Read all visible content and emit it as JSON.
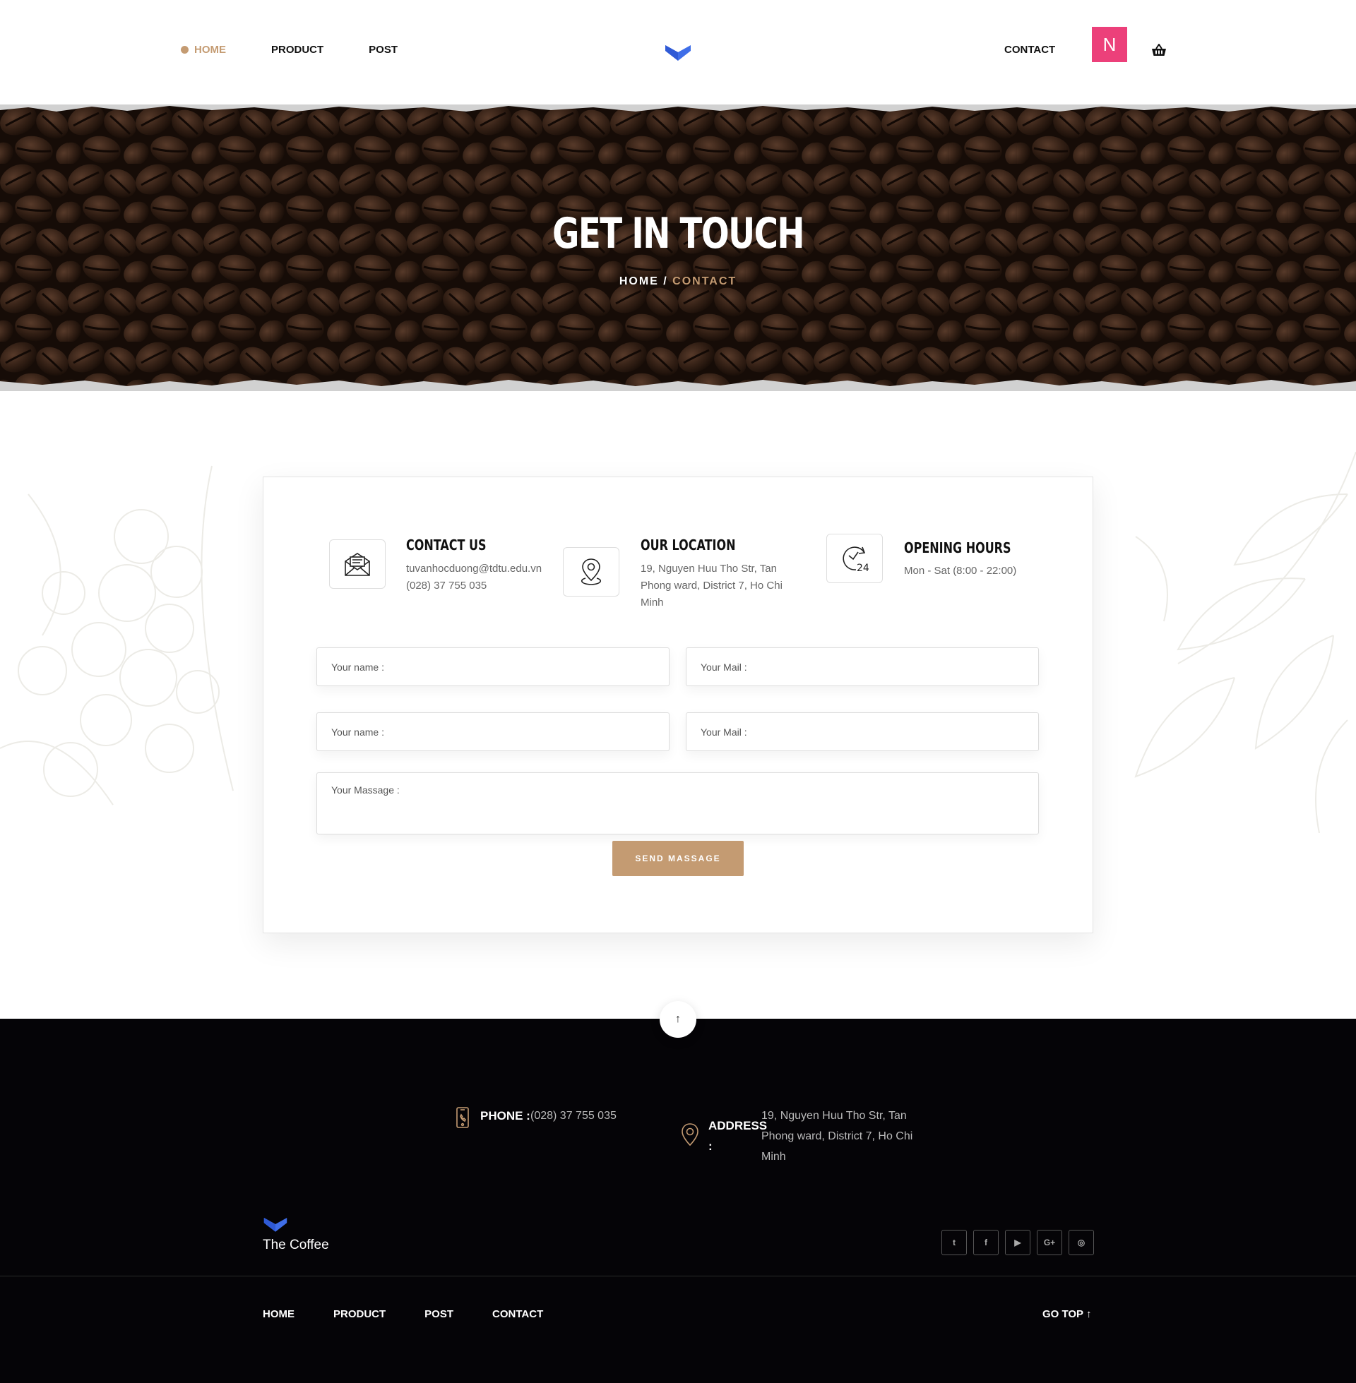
{
  "nav": {
    "items": [
      {
        "label": "HOME",
        "active": true
      },
      {
        "label": "PRODUCT",
        "active": false
      },
      {
        "label": "POST",
        "active": false
      }
    ],
    "contact_label": "CONTACT",
    "avatar_letter": "N"
  },
  "hero": {
    "title": "GET IN TOUCH",
    "breadcrumb_home": "HOME",
    "breadcrumb_separator": " / ",
    "breadcrumb_current": "CONTACT"
  },
  "info": {
    "contact": {
      "title": "CONTACT US",
      "email": "tuvanhocduong@tdtu.edu.vn",
      "phone": "(028) 37 755 035",
      "icon": "mail-icon"
    },
    "location": {
      "title": "OUR LOCATION",
      "line1": "19, Nguyen Huu Tho Str, Tan",
      "line2": "Phong ward, District 7, Ho Chi",
      "line3": "Minh",
      "icon": "map-pin-icon"
    },
    "hours": {
      "title": "OPENING HOURS",
      "text": "Mon - Sat (8:00 - 22:00)",
      "icon": "clock-24-icon"
    }
  },
  "form": {
    "name_placeholder": "Your name :",
    "mail_placeholder": "Your Mail :",
    "name2_placeholder": "Your name :",
    "mail2_placeholder": "Your Mail :",
    "message_placeholder": "Your Massage :",
    "send_label": "SEND MASSAGE"
  },
  "footer": {
    "phone_label": "PHONE :",
    "phone_value": "(028) 37 755 035",
    "address_label": "ADDRESS",
    "address_colon": ":",
    "address_line1": "19, Nguyen Huu Tho Str, Tan",
    "address_line2": "Phong ward, District 7, Ho Chi",
    "address_line3": "Minh",
    "brand": "The Coffee",
    "socials": [
      {
        "icon": "twitter-icon",
        "glyph": "t"
      },
      {
        "icon": "facebook-icon",
        "glyph": "f"
      },
      {
        "icon": "youtube-icon",
        "glyph": "▶"
      },
      {
        "icon": "google-plus-icon",
        "glyph": "G+"
      },
      {
        "icon": "instagram-icon",
        "glyph": "◎"
      }
    ],
    "nav": [
      "HOME",
      "PRODUCT",
      "POST",
      "CONTACT"
    ],
    "go_top": "GO TOP ↑"
  },
  "colors": {
    "accent": "#c49b72",
    "avatar": "#ec407a",
    "logo": "#3f6ee8",
    "footer_bg": "#050407"
  }
}
